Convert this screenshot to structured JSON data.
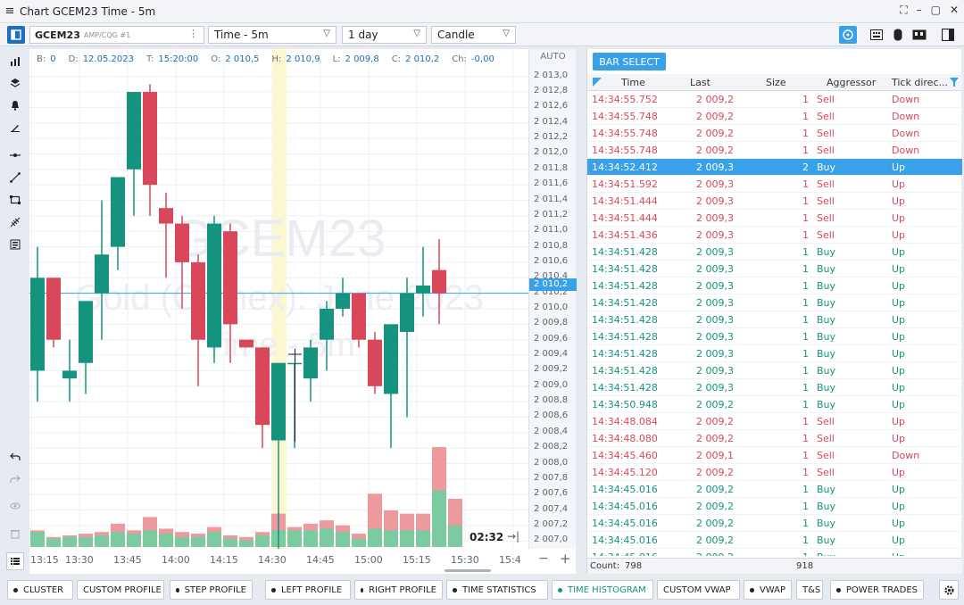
{
  "window": {
    "title": "Chart GCEM23 Time - 5m",
    "menu_glyph": "≡",
    "buttons": [
      "⛶",
      "–",
      "▢",
      "✕"
    ]
  },
  "toolbar": {
    "symbol": "GCEM23",
    "symbol_sub": "AMP/CQG #1",
    "interval": "Time - 5m",
    "period": "1 day",
    "chart_type": "Candle"
  },
  "info": {
    "B_label": "B:",
    "B": "0",
    "D_label": "D:",
    "D": "12.05.2023",
    "T_label": "T:",
    "T": "15:20:00",
    "O_label": "O:",
    "O": "2 010,5",
    "H_label": "H:",
    "H": "2 010,9",
    "L_label": "L:",
    "L": "2 009,8",
    "C_label": "C:",
    "C": "2 010,2",
    "Ch_label": "Ch:",
    "Ch": "-0,00"
  },
  "watermark": {
    "line1": "GCEM23",
    "line2": "Gold (Comex): June 2023",
    "line3": "Time - 5m"
  },
  "price_axis": {
    "auto": "AUTO",
    "current": "2 010,2"
  },
  "timer": "02:32",
  "chart_data": {
    "type": "candlestick",
    "ylim": [
      2006.9,
      2013.1
    ],
    "y_ticks": [
      "2 013,0",
      "2 012,8",
      "2 012,6",
      "2 012,4",
      "2 012,2",
      "2 012,0",
      "2 011,8",
      "2 011,6",
      "2 011,4",
      "2 011,2",
      "2 011,0",
      "2 010,8",
      "2 010,6",
      "2 010,4",
      "2 010,2",
      "2 010,0",
      "2 009,8",
      "2 009,6",
      "2 009,4",
      "2 009,2",
      "2 009,0",
      "2 008,8",
      "2 008,6",
      "2 008,4",
      "2 008,2",
      "2 008,0",
      "2 007,8",
      "2 007,6",
      "2 007,4",
      "2 007,2",
      "2 007,0"
    ],
    "x_ticks": [
      "13:15",
      "13:30",
      "13:45",
      "14:00",
      "14:15",
      "14:30",
      "14:45",
      "15:00",
      "15:15",
      "15:30",
      "15:4"
    ],
    "candles": [
      {
        "o": 2009.2,
        "h": 2010.8,
        "l": 2008.8,
        "c": 2010.4
      },
      {
        "o": 2010.4,
        "h": 2010.4,
        "l": 2009.5,
        "c": 2009.6
      },
      {
        "o": 2009.1,
        "h": 2009.6,
        "l": 2008.8,
        "c": 2009.2
      },
      {
        "o": 2009.3,
        "h": 2010.1,
        "l": 2008.9,
        "c": 2010.1
      },
      {
        "o": 2010.2,
        "h": 2011.4,
        "l": 2009.6,
        "c": 2010.7
      },
      {
        "o": 2010.8,
        "h": 2011.7,
        "l": 2010.5,
        "c": 2011.7
      },
      {
        "o": 2011.8,
        "h": 2012.8,
        "l": 2011.2,
        "c": 2012.8
      },
      {
        "o": 2012.8,
        "h": 2012.9,
        "l": 2011.2,
        "c": 2011.6
      },
      {
        "o": 2011.3,
        "h": 2011.5,
        "l": 2010.4,
        "c": 2011.1
      },
      {
        "o": 2011.1,
        "h": 2011.2,
        "l": 2010.0,
        "c": 2010.6
      },
      {
        "o": 2010.6,
        "h": 2010.7,
        "l": 2009.0,
        "c": 2009.6
      },
      {
        "o": 2009.5,
        "h": 2011.2,
        "l": 2009.3,
        "c": 2011.1
      },
      {
        "o": 2011.0,
        "h": 2011.1,
        "l": 2009.3,
        "c": 2009.8
      },
      {
        "o": 2009.6,
        "h": 2009.6,
        "l": 2009.5,
        "c": 2009.5
      },
      {
        "o": 2009.5,
        "h": 2009.5,
        "l": 2008.2,
        "c": 2008.5
      },
      {
        "o": 2008.3,
        "h": 2009.3,
        "l": 2005.5,
        "c": 2009.3
      },
      {
        "o": 2009.3,
        "h": 2009.3,
        "l": 2008.2,
        "c": 2009.3
      },
      {
        "o": 2009.1,
        "h": 2009.6,
        "l": 2008.8,
        "c": 2009.5
      },
      {
        "o": 2009.6,
        "h": 2010.1,
        "l": 2009.2,
        "c": 2010.0
      },
      {
        "o": 2010.0,
        "h": 2010.4,
        "l": 2009.9,
        "c": 2010.2
      },
      {
        "o": 2010.2,
        "h": 2010.2,
        "l": 2009.5,
        "c": 2009.6
      },
      {
        "o": 2009.6,
        "h": 2009.7,
        "l": 2008.9,
        "c": 2009.0
      },
      {
        "o": 2008.9,
        "h": 2009.8,
        "l": 2008.2,
        "c": 2009.8
      },
      {
        "o": 2009.7,
        "h": 2010.4,
        "l": 2008.6,
        "c": 2010.2
      },
      {
        "o": 2010.2,
        "h": 2010.8,
        "l": 2009.9,
        "c": 2010.3
      },
      {
        "o": 2010.5,
        "h": 2010.9,
        "l": 2009.8,
        "c": 2010.2
      }
    ],
    "volumes": [
      {
        "up": 1.0,
        "down": 0.9
      },
      {
        "up": 0.6,
        "down": 0.5
      },
      {
        "up": 0.7,
        "down": 0.6
      },
      {
        "up": 0.8,
        "down": 0.6
      },
      {
        "up": 0.9,
        "down": 0.7
      },
      {
        "up": 1.4,
        "down": 0.9
      },
      {
        "up": 1.0,
        "down": 0.8
      },
      {
        "up": 1.8,
        "down": 1.0
      },
      {
        "up": 1.1,
        "down": 0.8
      },
      {
        "up": 0.9,
        "down": 0.6
      },
      {
        "up": 0.8,
        "down": 0.6
      },
      {
        "up": 1.2,
        "down": 0.9
      },
      {
        "up": 0.7,
        "down": 0.5
      },
      {
        "up": 0.6,
        "down": 0.4
      },
      {
        "up": 0.9,
        "down": 0.7
      },
      {
        "up": 2.0,
        "down": 1.0
      },
      {
        "up": 1.2,
        "down": 1.0
      },
      {
        "up": 1.4,
        "down": 1.0
      },
      {
        "up": 1.6,
        "down": 1.1
      },
      {
        "up": 1.3,
        "down": 0.9
      },
      {
        "up": 0.8,
        "down": 0.5
      },
      {
        "up": 3.2,
        "down": 1.1
      },
      {
        "up": 2.2,
        "down": 1.0
      },
      {
        "up": 2.0,
        "down": 1.0
      },
      {
        "up": 2.0,
        "down": 1.0
      },
      {
        "up": 6.0,
        "down": 3.4
      },
      {
        "up": 2.9,
        "down": 1.3
      }
    ],
    "colors": {
      "up": "#15937f",
      "down": "#d9475a",
      "vol_up": "#7bcaa0",
      "vol_down": "#ec9a9e",
      "highlight": "#fbf7d0"
    }
  },
  "ts": {
    "bar_select": "BAR SELECT",
    "headers": {
      "time": "Time",
      "last": "Last",
      "size": "Size",
      "aggressor": "Aggressor",
      "tick": "Tick direc..."
    },
    "rows": [
      [
        "14:34:55.752",
        "2 009,2",
        "1",
        "Sell",
        "Down"
      ],
      [
        "14:34:55.748",
        "2 009,2",
        "1",
        "Sell",
        "Down"
      ],
      [
        "14:34:55.748",
        "2 009,2",
        "1",
        "Sell",
        "Down"
      ],
      [
        "14:34:55.748",
        "2 009,2",
        "1",
        "Sell",
        "Down"
      ],
      [
        "14:34:52.412",
        "2 009,3",
        "2",
        "Buy",
        "Up"
      ],
      [
        "14:34:51.592",
        "2 009,3",
        "1",
        "Sell",
        "Up"
      ],
      [
        "14:34:51.444",
        "2 009,3",
        "1",
        "Sell",
        "Up"
      ],
      [
        "14:34:51.444",
        "2 009,3",
        "1",
        "Sell",
        "Up"
      ],
      [
        "14:34:51.436",
        "2 009,3",
        "1",
        "Sell",
        "Up"
      ],
      [
        "14:34:51.428",
        "2 009,3",
        "1",
        "Buy",
        "Up"
      ],
      [
        "14:34:51.428",
        "2 009,3",
        "1",
        "Buy",
        "Up"
      ],
      [
        "14:34:51.428",
        "2 009,3",
        "1",
        "Buy",
        "Up"
      ],
      [
        "14:34:51.428",
        "2 009,3",
        "1",
        "Buy",
        "Up"
      ],
      [
        "14:34:51.428",
        "2 009,3",
        "1",
        "Buy",
        "Up"
      ],
      [
        "14:34:51.428",
        "2 009,3",
        "1",
        "Buy",
        "Up"
      ],
      [
        "14:34:51.428",
        "2 009,3",
        "1",
        "Buy",
        "Up"
      ],
      [
        "14:34:51.428",
        "2 009,3",
        "1",
        "Buy",
        "Up"
      ],
      [
        "14:34:51.428",
        "2 009,3",
        "1",
        "Buy",
        "Up"
      ],
      [
        "14:34:50.948",
        "2 009,2",
        "1",
        "Buy",
        "Up"
      ],
      [
        "14:34:48.084",
        "2 009,2",
        "1",
        "Sell",
        "Up"
      ],
      [
        "14:34:48.080",
        "2 009,2",
        "1",
        "Sell",
        "Up"
      ],
      [
        "14:34:45.460",
        "2 009,1",
        "1",
        "Sell",
        "Down"
      ],
      [
        "14:34:45.120",
        "2 009,2",
        "1",
        "Sell",
        "Up"
      ],
      [
        "14:34:45.016",
        "2 009,2",
        "1",
        "Buy",
        "Up"
      ],
      [
        "14:34:45.016",
        "2 009,2",
        "1",
        "Buy",
        "Up"
      ],
      [
        "14:34:45.016",
        "2 009,2",
        "1",
        "Buy",
        "Up"
      ],
      [
        "14:34:45.016",
        "2 009,2",
        "1",
        "Buy",
        "Up"
      ],
      [
        "14:34:45.016",
        "2 009,2",
        "1",
        "Buy",
        "Up"
      ]
    ],
    "selected_row": 4,
    "count_label": "Count:",
    "count": "798",
    "count2": "918"
  },
  "bottom": {
    "items": [
      "CLUSTER",
      "CUSTOM PROFILE",
      "STEP PROFILE",
      "LEFT PROFILE",
      "RIGHT PROFILE",
      "TIME STATISTICS",
      "TIME HISTOGRAM",
      "CUSTOM VWAP",
      "VWAP",
      "T&S",
      "POWER TRADES"
    ],
    "active": "TIME HISTOGRAM"
  },
  "icons": {
    "menu": "menu-icon",
    "panel": "panel-toggle-icon",
    "settings": "gear-icon"
  }
}
